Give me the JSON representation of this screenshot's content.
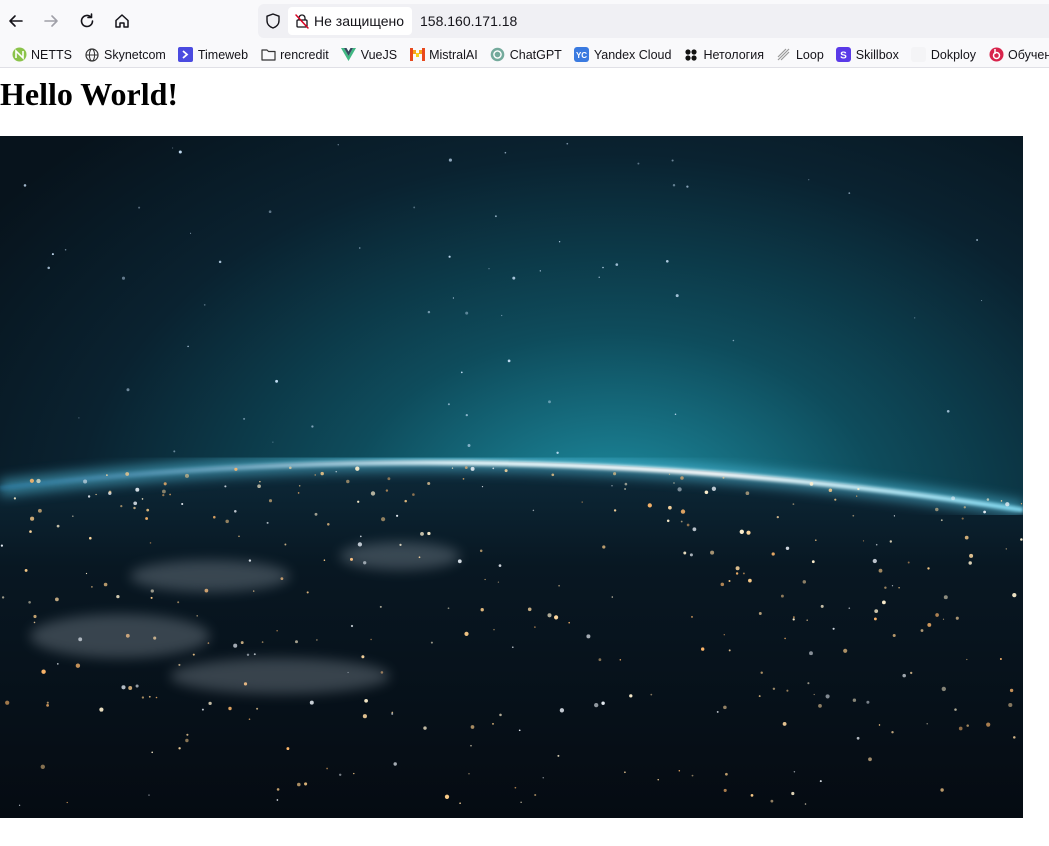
{
  "browser": {
    "security_label": "Не защищено",
    "url": "158.160.171.18"
  },
  "bookmarks": [
    {
      "label": "NETTS",
      "icon": "netts-icon",
      "color": "#3a9a3a"
    },
    {
      "label": "Skynetcom",
      "icon": "globe-icon",
      "color": "#333333"
    },
    {
      "label": "Timeweb",
      "icon": "timeweb-icon",
      "color": "#4a4ae0"
    },
    {
      "label": "rencredit",
      "icon": "folder-icon",
      "color": "#333333"
    },
    {
      "label": "VueJS",
      "icon": "vue-icon",
      "color": "#41b883"
    },
    {
      "label": "MistralAI",
      "icon": "mistral-icon",
      "color": "#f7a21b"
    },
    {
      "label": "ChatGPT",
      "icon": "chatgpt-icon",
      "color": "#74aa9c"
    },
    {
      "label": "Yandex Cloud",
      "icon": "yandex-cloud-icon",
      "color": "#3a7ae0"
    },
    {
      "label": "Нетология",
      "icon": "netology-icon",
      "color": "#111111"
    },
    {
      "label": "Loop",
      "icon": "loop-icon",
      "color": "#999999"
    },
    {
      "label": "Skillbox",
      "icon": "skillbox-icon",
      "color": "#5a3ae8"
    },
    {
      "label": "Dokploy",
      "icon": "dokploy-icon",
      "color": "#eeeeee"
    },
    {
      "label": "Обучение Битр",
      "icon": "bitrix-icon",
      "color": "#d8244c"
    }
  ],
  "page": {
    "heading": "Hello World!"
  }
}
